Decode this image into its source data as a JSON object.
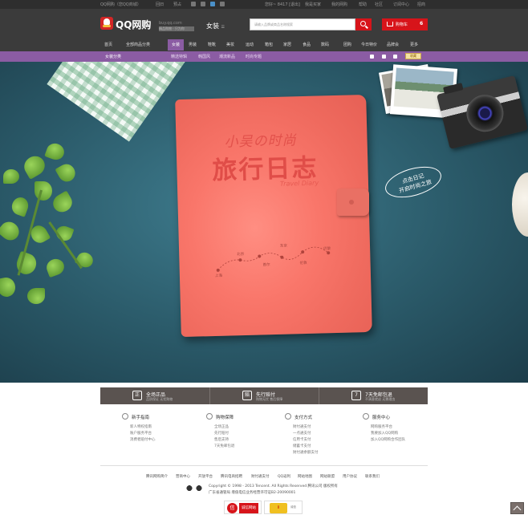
{
  "topbar": {
    "user": "QQ网购（您QQ商城）",
    "links_left": [
      "回旧",
      "预占"
    ],
    "links_right": [
      "您好~ 8417 [退出]",
      "我是买家",
      "我的网购",
      "帮助",
      "社区",
      "订阅中心",
      "招商"
    ],
    "site_tag": "buy.qq.com",
    "slogan": "精品购物 · 只为你"
  },
  "header": {
    "logo_text": "QQ网购",
    "category": "女装",
    "category_sub": "☰",
    "search_placeholder": "请输入品牌或商品名称搜索",
    "cart_label": "购物车",
    "cart_count": "6"
  },
  "nav": {
    "items": [
      "首页",
      "全部商品分类",
      "女装",
      "男装",
      "鞋靴",
      "美妆",
      "运动",
      "箱包",
      "家居",
      "食品",
      "数码",
      "团购",
      "今日特价",
      "品牌会",
      "更多"
    ],
    "active": "女装"
  },
  "purplebar": {
    "category": "女装分类",
    "links": [
      "精选特辑",
      "韩国风",
      "潮流新品",
      "时尚专题"
    ],
    "fav": "收藏"
  },
  "banner": {
    "title_small": "小吴の时尚",
    "title_big": "旅行日志",
    "subtitle": "Travel Diary",
    "cta_line1": "点击日记",
    "cta_line2": "开启时尚之旅",
    "route": [
      "上海",
      "北京",
      "首尔",
      "东京",
      "伦敦",
      "巴黎"
    ]
  },
  "features": [
    {
      "icon": "正",
      "title": "全场正品",
      "sub": "品质保证 无忧购物"
    },
    {
      "icon": "赔",
      "title": "先行赔付",
      "sub": "购物无忧 售后保障"
    },
    {
      "icon": "7",
      "title": "7天免邮包退",
      "sub": "不满意就退 无需理由"
    }
  ],
  "help": [
    {
      "title": "新手指南",
      "links": [
        "新人特权指南",
        "账户服务平台",
        "消费者赔付中心"
      ]
    },
    {
      "title": "购物保障",
      "links": [
        "全场正品",
        "先行赔付",
        "售后支持",
        "7天免邮包退"
      ]
    },
    {
      "title": "支付方式",
      "links": [
        "财付通支付",
        "一点通支付",
        "信用卡支付",
        "储蓄卡支付",
        "财付通余额支付"
      ]
    },
    {
      "title": "服务中心",
      "links": [
        "网购服务平台",
        "我要加入QQ网购",
        "加入QQ网购合作团队"
      ]
    }
  ],
  "footer": {
    "links": [
      "腾讯网购简介",
      "营商中心",
      "开放平台",
      "腾讯电商招聘",
      "财付通支付",
      "QQ返利",
      "网站地图",
      "网站联盟",
      "用户协议",
      "联系我们"
    ],
    "copyright": "Copyright © 1998 - 2013 Tencent. All Rights Reserved 腾讯公司 版权所有",
    "license": "广东省通管局 增值电信业务经营许可证B2-20090001",
    "badge1": "诚信网站",
    "badge2": "诚信"
  }
}
